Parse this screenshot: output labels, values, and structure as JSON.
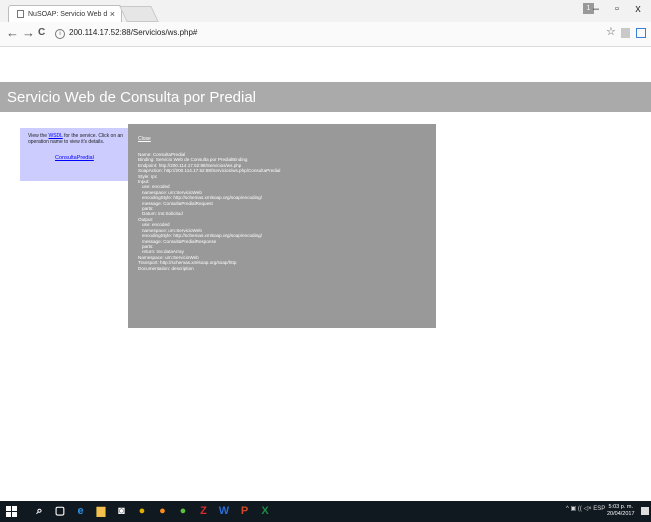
{
  "browser": {
    "tab_title": "NuSOAP: Servicio Web d",
    "tab_close": "×",
    "address": "200.114.17.52:88/Servicios/ws.php#",
    "user_badge": "1",
    "nav_back": "←",
    "nav_forward": "→",
    "nav_reload": "C",
    "star": "☆",
    "window_min": "–",
    "window_max": "▫",
    "window_close": "x"
  },
  "page": {
    "title": "Servicio Web de Consulta por Predial",
    "intro_prefix": "View the",
    "wsdl_link": "WSDL",
    "intro_suffix": "for the service. Click on an operation name to view it's details.",
    "operation_link": "ConsultaPredial"
  },
  "popup": {
    "close": "Close",
    "lines": [
      {
        "k": "Name:",
        "v": "ConsultaPredial"
      },
      {
        "k": "Binding:",
        "v": "Servicio Web de Consulta por PredialBinding"
      },
      {
        "k": "Endpoint:",
        "v": "http://200.114.17.52:88/Servicios/ws.php"
      },
      {
        "k": "SoapAction:",
        "v": "http://200.114.17.52:88/Servicios/ws.php/ConsultaPredial"
      },
      {
        "k": "Style:",
        "v": "rpc"
      },
      {
        "k": "Input:",
        "v": ""
      },
      {
        "k": "",
        "v": "use: encoded",
        "ind": true
      },
      {
        "k": "",
        "v": "namespace: urn:ServicioWeb",
        "ind": true
      },
      {
        "k": "",
        "v": "encodingStyle: http://schemas.xmlsoap.org/soap/encoding/",
        "ind": true
      },
      {
        "k": "",
        "v": "message: ConsultaPredialRequest",
        "ind": true
      },
      {
        "k": "",
        "v": "parts:",
        "ind": true
      },
      {
        "k": "",
        "v": "Datum: tns:Solicitud",
        "ind": true
      },
      {
        "k": "Output:",
        "v": ""
      },
      {
        "k": "",
        "v": "use: encoded",
        "ind": true
      },
      {
        "k": "",
        "v": "namespace: urn:ServicioWeb",
        "ind": true
      },
      {
        "k": "",
        "v": "encodingStyle: http://schemas.xmlsoap.org/soap/encoding/",
        "ind": true
      },
      {
        "k": "",
        "v": "message: ConsultaPredialResponse",
        "ind": true
      },
      {
        "k": "",
        "v": "parts:",
        "ind": true
      },
      {
        "k": "",
        "v": "return: tns:dataArray",
        "ind": true
      },
      {
        "k": "Namespace:",
        "v": "urn:ServicioWeb"
      },
      {
        "k": "Transport:",
        "v": "http://schemas.xmlsoap.org/soap/http"
      },
      {
        "k": "Documentation:",
        "v": "description"
      }
    ]
  },
  "taskbar": {
    "tray": "^ ▣ (( ◁× ESP",
    "time": "5:03 p. m.",
    "date": "20/04/2017",
    "apps": [
      {
        "icon": "search-icon",
        "glyph": "⌕",
        "color": "#ffffff"
      },
      {
        "icon": "task-view-icon",
        "glyph": "▢",
        "color": "#ffffff"
      },
      {
        "icon": "edge-icon",
        "glyph": "e",
        "color": "#2d8fe0"
      },
      {
        "icon": "file-explorer-icon",
        "glyph": "▆",
        "color": "#f2c14e"
      },
      {
        "icon": "store-icon",
        "glyph": "◙",
        "color": "#ffffff"
      },
      {
        "icon": "chrome-icon",
        "glyph": "●",
        "color": "#e0b000"
      },
      {
        "icon": "firefox-icon",
        "glyph": "●",
        "color": "#ff8c1a"
      },
      {
        "icon": "app-green-icon",
        "glyph": "●",
        "color": "#5fbf3a"
      },
      {
        "icon": "filezilla-icon",
        "glyph": "Z",
        "color": "#d92b2b"
      },
      {
        "icon": "word-icon",
        "glyph": "W",
        "color": "#2b6cd4"
      },
      {
        "icon": "powerpoint-icon",
        "glyph": "P",
        "color": "#d24726"
      },
      {
        "icon": "excel-icon",
        "glyph": "X",
        "color": "#1e8a44"
      }
    ]
  }
}
